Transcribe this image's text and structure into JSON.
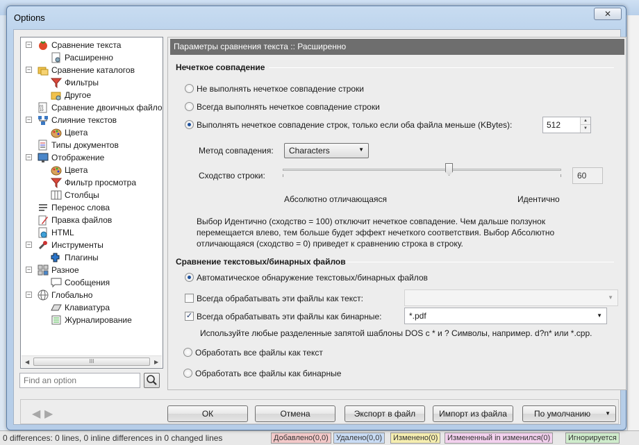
{
  "dialog": {
    "title": "Options",
    "close_glyph": "✕"
  },
  "tree": {
    "items": [
      {
        "label": "Сравнение текста",
        "level": 0,
        "toggle": "−",
        "icon": "tomato-icon"
      },
      {
        "label": "Расширенно",
        "level": 1,
        "icon": "settings-page-icon"
      },
      {
        "label": "Сравнение каталогов",
        "level": 0,
        "toggle": "−",
        "icon": "folders-icon"
      },
      {
        "label": "Фильтры",
        "level": 1,
        "icon": "filter-icon"
      },
      {
        "label": "Другое",
        "level": 1,
        "icon": "folder-gear-icon"
      },
      {
        "label": "Сравнение двоичных файло",
        "level": 0,
        "icon": "binary-icon"
      },
      {
        "label": "Слияние текстов",
        "level": 0,
        "toggle": "−",
        "icon": "merge-icon"
      },
      {
        "label": "Цвета",
        "level": 1,
        "icon": "palette-icon"
      },
      {
        "label": "Типы документов",
        "level": 0,
        "icon": "doc-types-icon"
      },
      {
        "label": "Отображение",
        "level": 0,
        "toggle": "−",
        "icon": "monitor-icon"
      },
      {
        "label": "Цвета",
        "level": 1,
        "icon": "palette-icon"
      },
      {
        "label": "Фильтр просмотра",
        "level": 1,
        "icon": "filter-icon"
      },
      {
        "label": "Столбцы",
        "level": 1,
        "icon": "columns-icon"
      },
      {
        "label": "Перенос слова",
        "level": 0,
        "icon": "wordwrap-icon"
      },
      {
        "label": "Правка файлов",
        "level": 0,
        "icon": "edit-pencil-icon"
      },
      {
        "label": "HTML",
        "level": 0,
        "icon": "html-globe-icon"
      },
      {
        "label": "Инструменты",
        "level": 0,
        "toggle": "−",
        "icon": "tools-icon"
      },
      {
        "label": "Плагины",
        "level": 1,
        "icon": "plugin-icon"
      },
      {
        "label": "Разное",
        "level": 0,
        "toggle": "−",
        "icon": "misc-icon"
      },
      {
        "label": "Сообщения",
        "level": 1,
        "icon": "message-icon"
      },
      {
        "label": "Глобально",
        "level": 0,
        "toggle": "−",
        "icon": "globe-icon"
      },
      {
        "label": "Клавиатура",
        "level": 1,
        "icon": "keyboard-icon"
      },
      {
        "label": "Журналирование",
        "level": 1,
        "icon": "log-icon"
      }
    ],
    "scroll_thumb_glyph": "III"
  },
  "search": {
    "placeholder": "Find an option"
  },
  "panel": {
    "header": "Параметры сравнения текста :: Расширенно",
    "fuzzy": {
      "title": "Нечеткое совпадение",
      "opt_never": "Не выполнять нечеткое совпадение строки",
      "opt_always": "Всегда выполнять нечеткое совпадение строки",
      "opt_conditional": "Выполнять нечеткое совпадение строк, только если оба файла меньше (KBytes):",
      "selected": "conditional",
      "kbytes_value": "512",
      "method_label": "Метод совпадения:",
      "method_value": "Characters",
      "similarity_label": "Сходство строки:",
      "similarity_value": "60",
      "slider_fraction": 0.6,
      "slider_min_label": "Абсолютно отличающаяся",
      "slider_max_label": "Идентично",
      "description": "Выбор Идентично (сходство = 100) отключит нечеткое совпадение. Чем дальше ползунок перемещается влево, тем больше будет эффект нечеткого соответствия. Выбор Абсолютно отличающаяся (сходство = 0) приведет к сравнению строка в строку."
    },
    "textbin": {
      "title": "Сравнение текстовых/бинарных файлов",
      "opt_auto": "Автоматическое обнаружение текстовых/бинарных файлов",
      "always_text_label": "Всегда обрабатывать эти файлы как текст:",
      "always_text_checked": false,
      "always_text_value": "",
      "always_binary_label": "Всегда обрабатывать эти файлы как бинарные:",
      "always_binary_checked": true,
      "always_binary_value": "*.pdf",
      "hint": "Используйте любые разделенные запятой шаблоны DOS с * и ? Символы, например. d?n* или *.cpp.",
      "opt_all_text": "Обработать все файлы как текст",
      "opt_all_binary": "Обработать все файлы как бинарные",
      "selected": "auto"
    }
  },
  "buttons": {
    "ok": "ОК",
    "cancel": "Отмена",
    "export": "Экспорт в файл",
    "import": "Импорт из файла",
    "defaults": "По умолчанию"
  },
  "background": {
    "status_text": "0 differences: 0 lines, 0 inline differences in 0 changed lines",
    "badges": [
      {
        "label": "Добавлено(0,0)",
        "color": "#f3c9c9"
      },
      {
        "label": "Удалено(0,0)",
        "color": "#c9dcf5"
      },
      {
        "label": "Изменено(0)",
        "color": "#f6eeb0"
      },
      {
        "label": "Измененный in изменился(0)",
        "color": "#f3d1ee"
      },
      {
        "label": "Игнорируется",
        "color": "#cfeccc"
      }
    ]
  },
  "colors": {
    "header_bg": "#6e6e6e",
    "radio_dot": "#1c4f9a",
    "dialog_frame": "#5d7ea6"
  }
}
